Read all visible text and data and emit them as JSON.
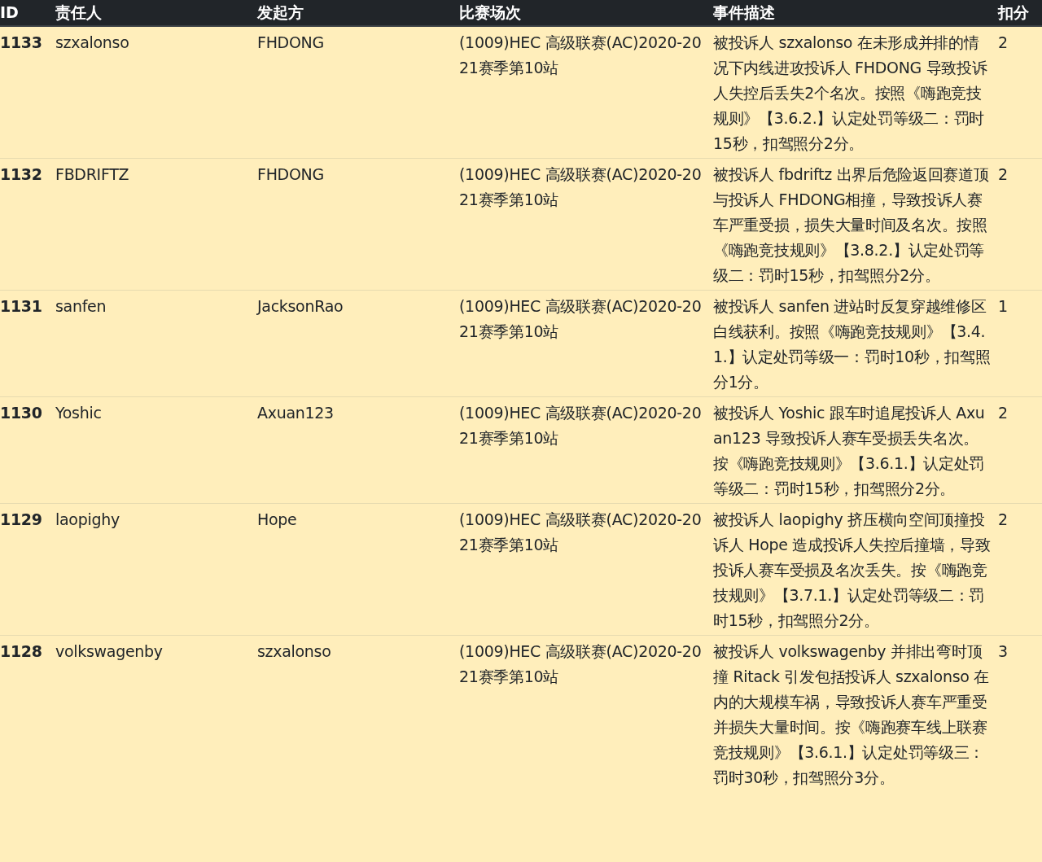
{
  "table": {
    "columns": [
      "ID",
      "责任人",
      "发起方",
      "比赛场次",
      "事件描述",
      "扣分"
    ],
    "rows": [
      {
        "id": "1133",
        "responsible": "szxalonso",
        "initiator": "FHDONG",
        "race": "(1009)HEC 高级联赛(AC)2020-2021赛季第10站",
        "description": "被投诉人 szxalonso 在未形成并排的情况下内线进攻投诉人 FHDONG 导致投诉人失控后丢失2个名次。按照《嗨跑竞技规则》【3.6.2.】认定处罚等级二：罚时15秒，扣驾照分2分。",
        "points": "2"
      },
      {
        "id": "1132",
        "responsible": "FBDRIFTZ",
        "initiator": "FHDONG",
        "race": "(1009)HEC 高级联赛(AC)2020-2021赛季第10站",
        "description": "被投诉人 fbdriftz 出界后危险返回赛道顶与投诉人 FHDONG相撞，导致投诉人赛车严重受损，损失大量时间及名次。按照《嗨跑竞技规则》【3.8.2.】认定处罚等级二：罚时15秒，扣驾照分2分。",
        "points": "2"
      },
      {
        "id": "1131",
        "responsible": "sanfen",
        "initiator": "JacksonRao",
        "race": "(1009)HEC 高级联赛(AC)2020-2021赛季第10站",
        "description": "被投诉人 sanfen 进站时反复穿越维修区白线获利。按照《嗨跑竞技规则》【3.4.1.】认定处罚等级一：罚时10秒，扣驾照分1分。",
        "points": "1"
      },
      {
        "id": "1130",
        "responsible": "Yoshic",
        "initiator": "Axuan123",
        "race": "(1009)HEC 高级联赛(AC)2020-2021赛季第10站",
        "description": "被投诉人 Yoshic 跟车时追尾投诉人 Axuan123 导致投诉人赛车受损丢失名次。按《嗨跑竞技规则》【3.6.1.】认定处罚等级二：罚时15秒，扣驾照分2分。",
        "points": "2"
      },
      {
        "id": "1129",
        "responsible": "laopighy",
        "initiator": "Hope",
        "race": "(1009)HEC 高级联赛(AC)2020-2021赛季第10站",
        "description": "被投诉人 laopighy 挤压横向空间顶撞投诉人 Hope 造成投诉人失控后撞墙，导致投诉人赛车受损及名次丢失。按《嗨跑竞技规则》【3.7.1.】认定处罚等级二：罚时15秒，扣驾照分2分。",
        "points": "2"
      },
      {
        "id": "1128",
        "responsible": "volkswagenby",
        "initiator": "szxalonso",
        "race": "(1009)HEC 高级联赛(AC)2020-2021赛季第10站",
        "description": "被投诉人 volkswagenby 并排出弯时顶撞 Ritack 引发包括投诉人 szxalonso 在内的大规模车祸，导致投诉人赛车严重受并损失大量时间。按《嗨跑赛车线上联赛竞技规则》【3.6.1.】认定处罚等级三：罚时30秒，扣驾照分3分。",
        "points": "3"
      }
    ]
  }
}
